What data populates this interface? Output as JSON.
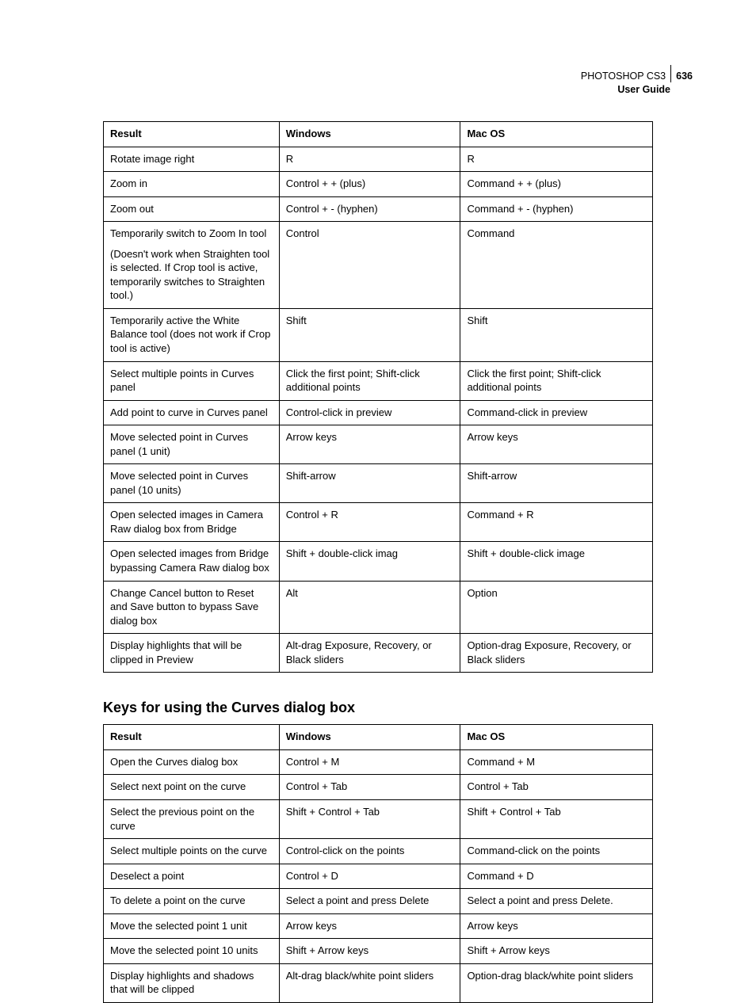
{
  "header": {
    "product": "PHOTOSHOP CS3",
    "page_number": "636",
    "guide": "User Guide"
  },
  "table1": {
    "headers": {
      "result": "Result",
      "windows": "Windows",
      "mac": "Mac OS"
    },
    "rows": [
      {
        "result": "Rotate image right",
        "win": "R",
        "mac": "R"
      },
      {
        "result": "Zoom in",
        "win": "Control + + (plus)",
        "mac": "Command + + (plus)"
      },
      {
        "result": "Zoom out",
        "win": "Control + - (hyphen)",
        "mac": "Command + - (hyphen)"
      },
      {
        "result": "Temporarily switch to Zoom In tool\n\n(Doesn't work when Straighten tool is selected. If Crop tool is active, temporarily switches to Straighten tool.)",
        "win": "Control",
        "mac": "Command"
      },
      {
        "result": "Temporarily active the White Balance tool (does not work if Crop tool is active)",
        "win": "Shift",
        "mac": "Shift"
      },
      {
        "result": "Select multiple points in Curves panel",
        "win": "Click the first point; Shift-click additional points",
        "mac": "Click the first point; Shift-click additional points"
      },
      {
        "result": "Add point to curve in Curves panel",
        "win": "Control-click in preview",
        "mac": "Command-click in preview"
      },
      {
        "result": "Move selected point in Curves panel (1 unit)",
        "win": "Arrow keys",
        "mac": "Arrow keys"
      },
      {
        "result": "Move selected point in Curves panel (10 units)",
        "win": "Shift-arrow",
        "mac": "Shift-arrow"
      },
      {
        "result": "Open selected images in Camera Raw dialog box from Bridge",
        "win": "Control + R",
        "mac": "Command + R"
      },
      {
        "result": "Open selected images from Bridge bypassing Camera Raw dialog box",
        "win": "Shift + double-click imag",
        "mac": "Shift + double-click image"
      },
      {
        "result": "Change Cancel button to Reset and Save button to bypass Save dialog box",
        "win": "Alt",
        "mac": "Option"
      },
      {
        "result": "Display highlights that will be clipped in Preview",
        "win": "Alt-drag Exposure, Recovery, or Black sliders",
        "mac": "Option-drag Exposure, Recovery, or Black sliders"
      }
    ]
  },
  "section2": {
    "title": "Keys for using the Curves dialog box"
  },
  "table2": {
    "headers": {
      "result": "Result",
      "windows": "Windows",
      "mac": "Mac OS"
    },
    "rows": [
      {
        "result": "Open the Curves dialog box",
        "win": "Control + M",
        "mac": "Command + M"
      },
      {
        "result": "Select next point on the curve",
        "win": "Control + Tab",
        "mac": "Control + Tab"
      },
      {
        "result": "Select the previous point on the curve",
        "win": "Shift + Control + Tab",
        "mac": "Shift + Control + Tab"
      },
      {
        "result": "Select multiple points on the curve",
        "win": "Control-click on the points",
        "mac": "Command-click on the points"
      },
      {
        "result": "Deselect a point",
        "win": "Control + D",
        "mac": "Command + D"
      },
      {
        "result": "To delete a point on the curve",
        "win": "Select a point and press Delete",
        "mac": "Select a point and press Delete."
      },
      {
        "result": "Move the selected point 1 unit",
        "win": "Arrow keys",
        "mac": "Arrow keys"
      },
      {
        "result": "Move the selected point 10 units",
        "win": "Shift + Arrow keys",
        "mac": "Shift + Arrow keys"
      },
      {
        "result": "Display highlights and shadows that will be clipped",
        "win": "Alt-drag black/white point sliders",
        "mac": "Option-drag black/white point sliders"
      }
    ]
  }
}
